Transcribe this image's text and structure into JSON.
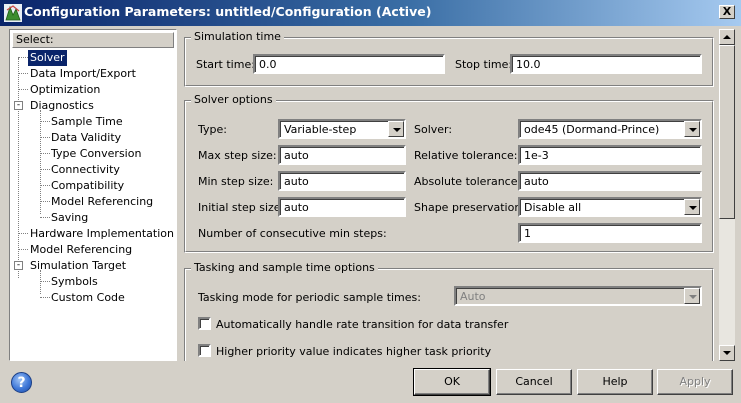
{
  "window": {
    "title": "Configuration Parameters: untitled/Configuration (Active)",
    "close_label": "X"
  },
  "tree": {
    "header": "Select:",
    "items": [
      {
        "label": "Solver",
        "level": 1,
        "selected": true
      },
      {
        "label": "Data Import/Export",
        "level": 1
      },
      {
        "label": "Optimization",
        "level": 1
      },
      {
        "label": "Diagnostics",
        "level": 1,
        "expander": "-"
      },
      {
        "label": "Sample Time",
        "level": 2
      },
      {
        "label": "Data Validity",
        "level": 2
      },
      {
        "label": "Type Conversion",
        "level": 2
      },
      {
        "label": "Connectivity",
        "level": 2
      },
      {
        "label": "Compatibility",
        "level": 2
      },
      {
        "label": "Model Referencing",
        "level": 2
      },
      {
        "label": "Saving",
        "level": 2
      },
      {
        "label": "Hardware Implementation",
        "level": 1
      },
      {
        "label": "Model Referencing",
        "level": 1
      },
      {
        "label": "Simulation Target",
        "level": 1,
        "expander": "-"
      },
      {
        "label": "Symbols",
        "level": 2
      },
      {
        "label": "Custom Code",
        "level": 2
      }
    ]
  },
  "simulation_time": {
    "title": "Simulation time",
    "start_label": "Start time:",
    "start_value": "0.0",
    "stop_label": "Stop time:",
    "stop_value": "10.0"
  },
  "solver_options": {
    "title": "Solver options",
    "type_label": "Type:",
    "type_value": "Variable-step",
    "solver_label": "Solver:",
    "solver_value": "ode45 (Dormand-Prince)",
    "max_step_label": "Max step size:",
    "max_step_value": "auto",
    "rel_tol_label": "Relative tolerance:",
    "rel_tol_value": "1e-3",
    "min_step_label": "Min step size:",
    "min_step_value": "auto",
    "abs_tol_label": "Absolute tolerance:",
    "abs_tol_value": "auto",
    "init_step_label": "Initial step size:",
    "init_step_value": "auto",
    "shape_label": "Shape preservation:",
    "shape_value": "Disable all",
    "consec_label": "Number of consecutive min steps:",
    "consec_value": "1"
  },
  "tasking": {
    "title": "Tasking and sample time options",
    "mode_label": "Tasking mode for periodic sample times:",
    "mode_value": "Auto",
    "auto_rate_label": "Automatically handle rate transition for data transfer",
    "auto_rate_checked": false,
    "priority_label": "Higher priority value indicates higher task priority",
    "priority_checked": false
  },
  "buttons": {
    "ok": "OK",
    "cancel": "Cancel",
    "help": "Help",
    "apply": "Apply"
  },
  "colors": {
    "dialog_bg": "#d4d0c8",
    "titlebar_start": "#0a246a",
    "titlebar_end": "#a6caf0",
    "selection": "#0a246a"
  }
}
